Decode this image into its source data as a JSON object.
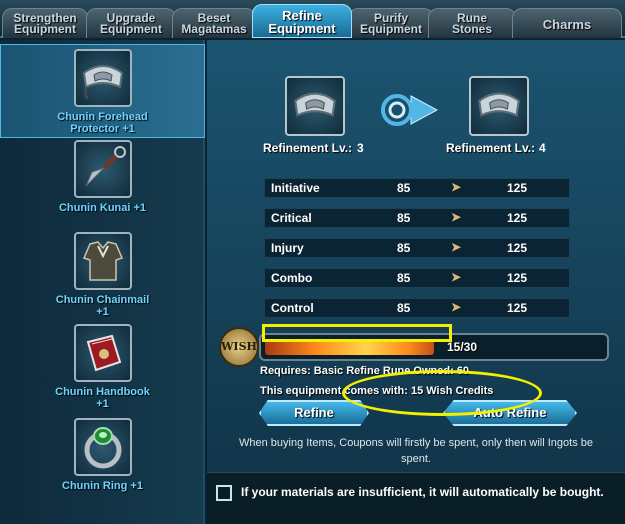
{
  "tabs": [
    {
      "label_line1": "Strengthen",
      "label_line2": "Equipment"
    },
    {
      "label_line1": "Upgrade",
      "label_line2": "Equipment"
    },
    {
      "label_line1": "Beset",
      "label_line2": "Magatamas"
    },
    {
      "label_line1": "Refine",
      "label_line2": "Equipment"
    },
    {
      "label_line1": "Purify",
      "label_line2": "Equipment"
    },
    {
      "label_line1": "Rune",
      "label_line2": "Stones"
    },
    {
      "label_line1": "Charms",
      "label_line2": ""
    }
  ],
  "active_tab": "Refine Equipment",
  "equipment_list": [
    {
      "name_line1": "Chunin Forehead",
      "name_line2": "Protector  +1",
      "icon": "forehead-protector-icon"
    },
    {
      "name_line1": "Chunin Kunai  +1",
      "name_line2": "",
      "icon": "kunai-icon"
    },
    {
      "name_line1": "Chunin Chainmail",
      "name_line2": "+1",
      "icon": "chainmail-icon"
    },
    {
      "name_line1": "Chunin Handbook",
      "name_line2": "+1",
      "icon": "handbook-icon"
    },
    {
      "name_line1": "Chunin Ring  +1",
      "name_line2": "",
      "icon": "ring-icon"
    }
  ],
  "refine": {
    "current_label": "Refinement Lv.:",
    "current_level": "3",
    "next_label": "Refinement Lv.:",
    "next_level": "4",
    "stats": [
      {
        "name": "Initiative",
        "from": "85",
        "to": "125"
      },
      {
        "name": "Critical",
        "from": "85",
        "to": "125"
      },
      {
        "name": "Injury",
        "from": "85",
        "to": "125"
      },
      {
        "name": "Combo",
        "from": "85",
        "to": "125"
      },
      {
        "name": "Control",
        "from": "85",
        "to": "125"
      }
    ],
    "arrow_glyph": "➤",
    "wish_badge": "WISH",
    "progress_text": "15/30",
    "progress_fraction": 0.5,
    "requires_text": "Requires: Basic Refine Rune  Owned: 60",
    "comes_with_text": "This equipment comes with: 15 Wish Credits",
    "refine_button": "Refine",
    "auto_refine_button": "Auto Refine",
    "note_line1": "When buying Items, Coupons will firstly be spent, only then will Ingots be",
    "note_line2": "spent.",
    "auto_buy_text": "If your materials are insufficient, it will automatically be bought."
  },
  "colors": {
    "accent": "#3cb0e0",
    "label_blue": "#6fd3ff",
    "annotation": "#f3f000"
  }
}
